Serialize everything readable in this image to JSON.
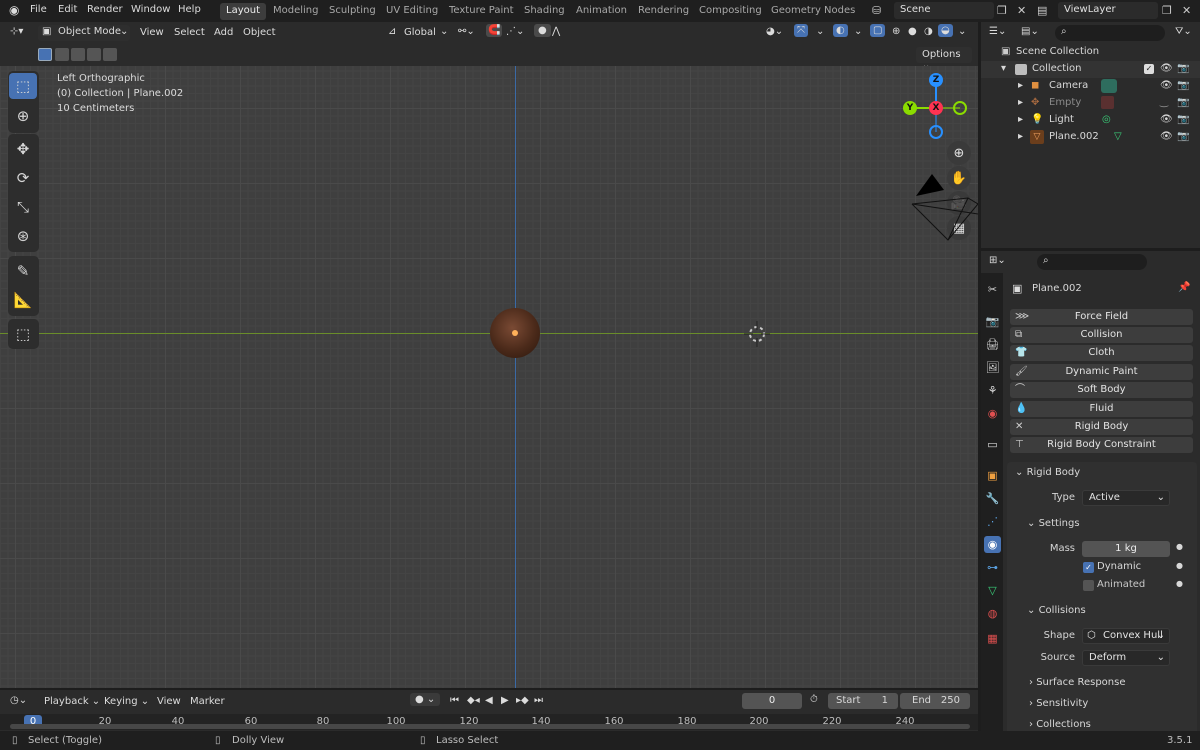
{
  "topbar": {
    "menus": [
      "File",
      "Edit",
      "Render",
      "Window",
      "Help"
    ],
    "workspaces": [
      "Layout",
      "Modeling",
      "Sculpting",
      "UV Editing",
      "Texture Paint",
      "Shading",
      "Animation",
      "Rendering",
      "Compositing",
      "Geometry Nodes"
    ],
    "active_workspace": "Layout",
    "scene": "Scene",
    "view_layer": "ViewLayer"
  },
  "viewport_header": {
    "mode": "Object Mode",
    "menus": [
      "View",
      "Select",
      "Add",
      "Object"
    ],
    "transform_orientation": "Global",
    "options": "Options"
  },
  "viewport": {
    "view_name": "Left Orthographic",
    "context": "(0) Collection | Plane.002",
    "scale": "10 Centimeters",
    "gizmo": {
      "z": "Z",
      "y": "Y",
      "x": "X"
    }
  },
  "outliner": {
    "root": "Scene Collection",
    "collection": "Collection",
    "items": [
      {
        "name": "Camera",
        "icon": "camera-icon"
      },
      {
        "name": "Empty",
        "icon": "empty-icon"
      },
      {
        "name": "Light",
        "icon": "light-icon"
      },
      {
        "name": "Plane.002",
        "icon": "mesh-icon"
      }
    ]
  },
  "properties": {
    "object_name": "Plane.002",
    "physics_buttons": [
      "Force Field",
      "Collision",
      "Cloth",
      "Dynamic Paint",
      "Soft Body",
      "Fluid",
      "Rigid Body",
      "Rigid Body Constraint"
    ],
    "rigid_body": {
      "title": "Rigid Body",
      "type_label": "Type",
      "type_value": "Active",
      "settings_title": "Settings",
      "mass_label": "Mass",
      "mass_value": "1 kg",
      "dynamic_label": "Dynamic",
      "dynamic_checked": true,
      "animated_label": "Animated",
      "animated_checked": false,
      "collisions_title": "Collisions",
      "shape_label": "Shape",
      "shape_value": "Convex Hull",
      "source_label": "Source",
      "source_value": "Deform",
      "surface_response": "Surface Response",
      "sensitivity": "Sensitivity",
      "collections": "Collections"
    }
  },
  "timeline": {
    "menus": [
      "Playback",
      "Keying",
      "View",
      "Marker"
    ],
    "current_frame": "0",
    "start_label": "Start",
    "start_value": "1",
    "end_label": "End",
    "end_value": "250",
    "ticks": [
      "0",
      "20",
      "40",
      "60",
      "80",
      "100",
      "120",
      "140",
      "160",
      "180",
      "200",
      "220",
      "240"
    ]
  },
  "statusbar": {
    "hint1": "Select (Toggle)",
    "hint2": "Dolly View",
    "hint3": "Lasso Select",
    "version": "3.5.1"
  },
  "colors": {
    "accent": "#4772b3",
    "x_axis": "#ff3352",
    "y_axis": "#8bdc00",
    "z_axis": "#2890ff",
    "y_line": "#6a8d2a",
    "z_line": "#3b6aa6"
  }
}
